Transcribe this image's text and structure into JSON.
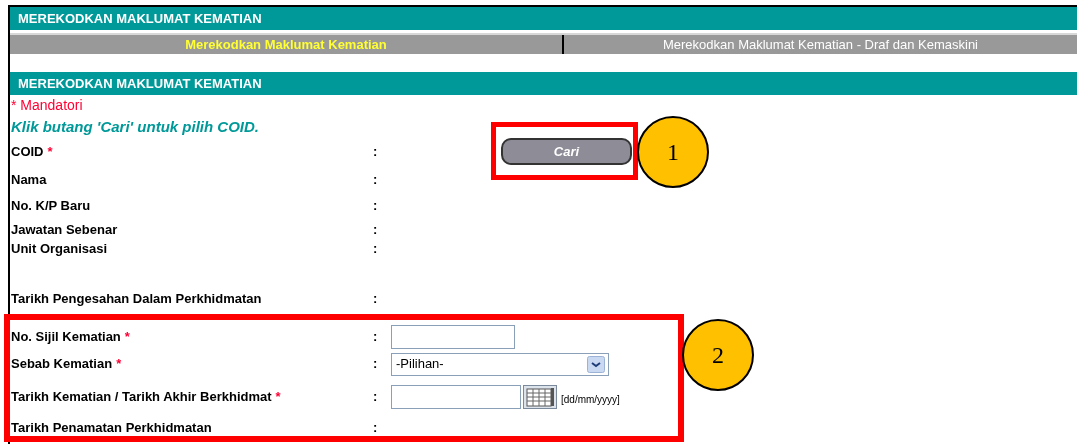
{
  "title": "MEREKODKAN MAKLUMAT KEMATIAN",
  "tabs": [
    {
      "label": "Merekodkan Maklumat Kematian",
      "selected": true
    },
    {
      "label": "Merekodkan Maklumat Kematian - Draf dan Kemaskini",
      "selected": false
    }
  ],
  "section_title": "MEREKODKAN MAKLUMAT KEMATIAN",
  "mandatory_note": "* Mandatori",
  "instruction": "Klik butang 'Cari' untuk pilih COID.",
  "fields": [
    {
      "label": "COID",
      "required_mark": "*",
      "separator": ":",
      "kind": "button",
      "button": "Cari"
    },
    {
      "label": "Nama",
      "separator": ":",
      "kind": "text"
    },
    {
      "label": "No. K/P Baru",
      "separator": ":",
      "kind": "text"
    },
    {
      "label": "Jawatan Sebenar",
      "separator": ":",
      "kind": "text"
    },
    {
      "label": "Unit Organisasi",
      "separator": ":",
      "kind": "text"
    },
    {
      "label": "Tarikh Pengesahan Dalam Perkhidmatan",
      "separator": ":",
      "kind": "text"
    },
    {
      "label": "No. Sijil Kematian",
      "required_mark": "*",
      "separator": ":",
      "kind": "input"
    },
    {
      "label": "Sebab Kematian",
      "required_mark": "*",
      "separator": ":",
      "kind": "select",
      "value": "-Pilihan-"
    },
    {
      "label": "Tarikh Kematian / Tarikh Akhir Berkhidmat",
      "required_mark": "*",
      "separator": ":",
      "kind": "date",
      "hint": "[dd/mm/yyyy]"
    },
    {
      "label": "Tarikh Penamatan Perkhidmatan",
      "separator": ":",
      "kind": "text"
    }
  ],
  "annotations": [
    {
      "number": "1"
    },
    {
      "number": "2"
    }
  ]
}
